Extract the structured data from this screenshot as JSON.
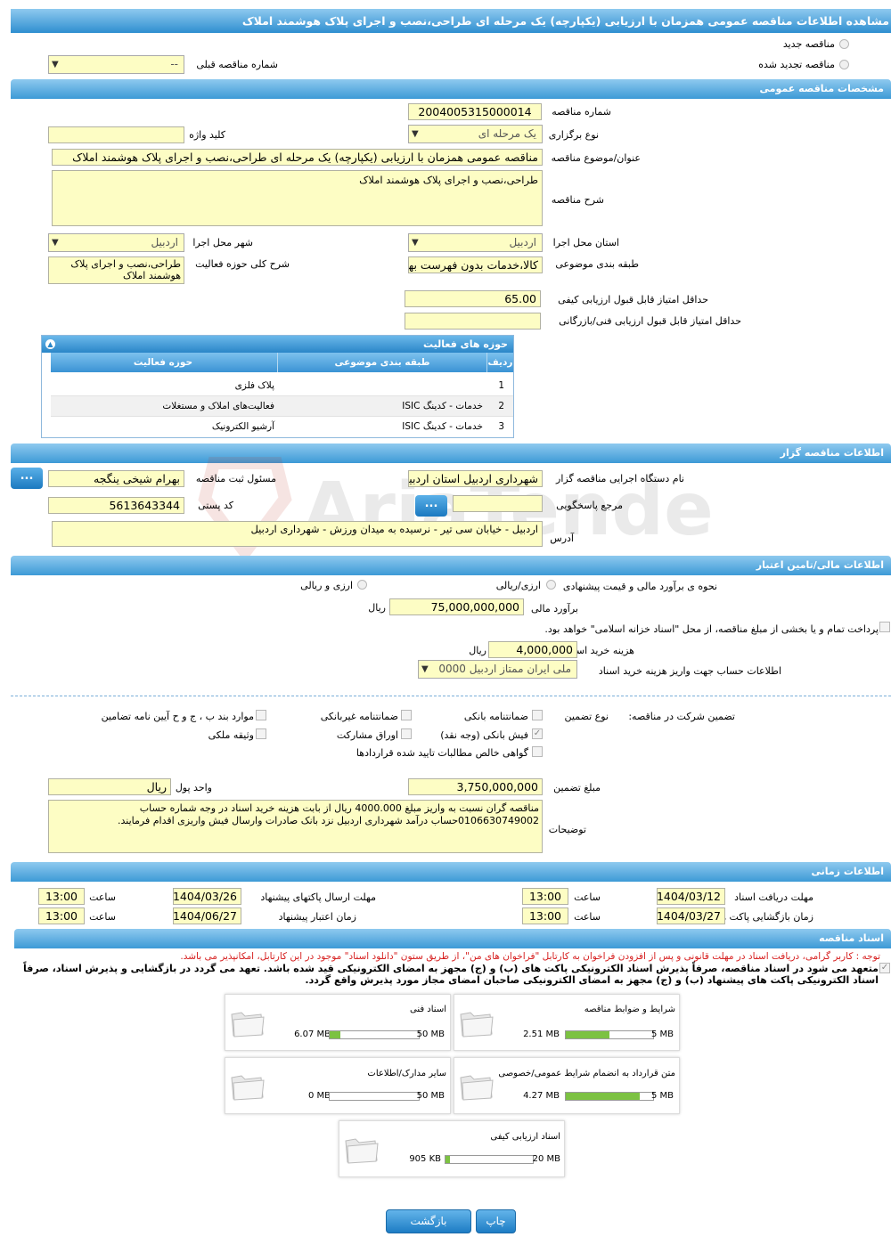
{
  "page_title": "مشاهده اطلاعات مناقصه عمومی همزمان با ارزیابی (یکپارچه) یک مرحله ای طراحی،نصب و اجرای پلاک هوشمند املاک",
  "top": {
    "new_tender": "مناقصه جدید",
    "renewed_tender": "مناقصه تجدید شده",
    "prev_tender_label": "شماره مناقصه قبلی",
    "prev_tender_value": "--"
  },
  "general": {
    "header": "مشخصات مناقصه عمومی",
    "tender_number_label": "شماره مناقصه",
    "tender_number": "2004005315000014",
    "holding_type_label": "نوع برگزاری",
    "holding_type": "یک مرحله ای",
    "keyword_label": "کلید واژه",
    "keyword": "",
    "subject_label": "عنوان/موضوع مناقصه",
    "subject": "مناقصه عمومی همزمان با ارزیابی (یکپارچه) یک مرحله ای طراحی،نصب و اجرای پلاک هوشمند املاک",
    "description_label": "شرح مناقصه",
    "description": "طراحی،نصب و اجرای پلاک هوشمند املاک",
    "province_label": "استان محل اجرا",
    "province": "اردبیل",
    "city_label": "شهر محل اجرا",
    "city": "اردبیل",
    "category_label": "طبقه بندی موضوعی",
    "category": "کالا،خدمات بدون فهرست بها",
    "activity_label": "شرح کلی حوزه فعالیت",
    "activity": "طراحی،نصب و اجرای پلاک هوشمند املاک",
    "min_quality_label": "حداقل امتیاز قابل قبول ارزیابی کیفی",
    "min_quality": "65.00",
    "min_tech_label": "حداقل امتیاز قابل قبول ارزیابی فنی/بازرگانی",
    "min_tech": ""
  },
  "activities": {
    "header": "حوزه های فعالیت",
    "col_row": "ردیف",
    "col_category": "طبقه بندی موضوعی",
    "col_field": "حوزه فعالیت",
    "rows": [
      {
        "n": "1",
        "category": "",
        "field": "پلاک فلزی"
      },
      {
        "n": "2",
        "category": "خدمات - کدینگ ISIC",
        "field": "فعالیت‌های  املاک و مستغلات"
      },
      {
        "n": "3",
        "category": "خدمات - کدینگ ISIC",
        "field": "آرشیو الکترونیک"
      }
    ]
  },
  "organizer": {
    "header": "اطلاعات مناقصه گزار",
    "org_label": "نام دستگاه اجرایی مناقصه گزار",
    "org": "شهرداری اردبیل استان اردبیل",
    "responsible_label": "مسئول ثبت مناقصه",
    "responsible": "بهرام شیخی ینگجه",
    "reference_label": "مرجع پاسخگویی",
    "reference": "",
    "postal_label": "کد پستی",
    "postal": "5613643344",
    "address_label": "آدرس",
    "address": "اردبیل - خیابان سی تیر - نرسیده به میدان ورزش - شهرداری اردبیل",
    "dots": "..."
  },
  "finance": {
    "header": "اطلاعات مالی/تامین اعتبار",
    "estimate_method_label": "نحوه ی برآورد مالی و قیمت پیشنهادی",
    "opt_rial": "ارزی/ریالی",
    "opt_fx": "ارزی و ریالی",
    "estimate_label": "برآورد مالی",
    "estimate": "75,000,000,000",
    "rial": "ریال",
    "islamic_note": "پرداخت تمام و یا بخشی از مبلغ مناقصه، از محل \"اسناد خزانه اسلامی\" خواهد بود.",
    "doc_cost_label": "هزینه خرید اسناد",
    "doc_cost": "4,000,000",
    "account_label": "اطلاعات حساب جهت واریز هزینه خرید اسناد",
    "account": "ملی ایران ممتاز اردبیل 0000"
  },
  "guarantee": {
    "participation_label": "تضمین شرکت در مناقصه:",
    "type_label": "نوع تضمین",
    "bank_guarantee": "ضمانتنامه بانکی",
    "non_bank_guarantee": "ضمانتنامه غیربانکی",
    "article_items": "موارد بند ب ، ج و ح آیین نامه تضامین",
    "bank_receipt": "فیش بانکی (وجه نقد)",
    "bonds": "اوراق مشارکت",
    "property": "وثیقه ملکی",
    "claims_cert": "گواهی خالص مطالبات تایید شده قراردادها",
    "amount_label": "مبلغ تضمین",
    "amount": "3,750,000,000",
    "currency_label": "واحد پول",
    "currency": "ریال",
    "notes_label": "توضیحات",
    "notes": "مناقصه گران نسبت به واریز مبلغ 4000.000 ریال از بابت هزینه خرید اسناد در وجه شماره حساب 0106630749002حساب درآمد شهرداری اردبیل نزد بانک صادرات وارسال فیش واریزی اقدام فرمایند."
  },
  "timing": {
    "header": "اطلاعات زمانی",
    "receive_deadline_label": "مهلت دریافت اسناد",
    "receive_deadline": "1404/03/12",
    "receive_time": "13:00",
    "send_deadline_label": "مهلت ارسال پاکتهای پیشنهاد",
    "send_deadline": "1404/03/26",
    "send_time": "13:00",
    "opening_label": "زمان بازگشایی پاکت ها",
    "opening": "1404/03/27",
    "opening_time": "13:00",
    "validity_label": "زمان اعتبار پیشنهاد",
    "validity": "1404/06/27",
    "validity_time": "13:00",
    "time_label": "ساعت"
  },
  "documents": {
    "header": "اسناد مناقصه",
    "notice": "توجه : کاربر گرامی، دریافت اسناد در مهلت قانونی و پس از افزودن فراخوان به کارتابل \"فراخوان های من\"، از طریق ستون \"دانلود اسناد\" موجود در این کارتابل، امکانپذیر می باشد.",
    "commitment": "متعهد می شود در اسناد مناقصه، صرفاً پذیرش اسناد الکترونیکی پاکت های (ب) و (ج) مجهز به امضای الکترونیکی قید شده باشد. تعهد می گردد در بازگشایی و پذیرش اسناد، صرفاً اسناد الکترونیکی پاکت های پیشنهاد (ب) و (ج) مجهز به امضای الکترونیکی صاحبان امضای مجاز مورد پذیرش واقع گردد.",
    "cards": [
      {
        "title": "شرایط و ضوابط مناقصه",
        "size": "2.51 MB",
        "max": "5 MB",
        "fill": 0.5
      },
      {
        "title": "اسناد فنی",
        "size": "6.07 MB",
        "max": "50 MB",
        "fill": 0.12
      },
      {
        "title": "متن قرارداد به انضمام شرایط عمومی/خصوصی",
        "size": "4.27 MB",
        "max": "5 MB",
        "fill": 0.85
      },
      {
        "title": "سایر مدارک/اطلاعات",
        "size": "0 MB",
        "max": "50 MB",
        "fill": 0.0
      },
      {
        "title": "اسناد ارزیابی کیفی",
        "size": "905 KB",
        "max": "20 MB",
        "fill": 0.05
      }
    ]
  },
  "buttons": {
    "print": "چاپ",
    "back": "بازگشت"
  },
  "watermark": "AriaTender.neT"
}
